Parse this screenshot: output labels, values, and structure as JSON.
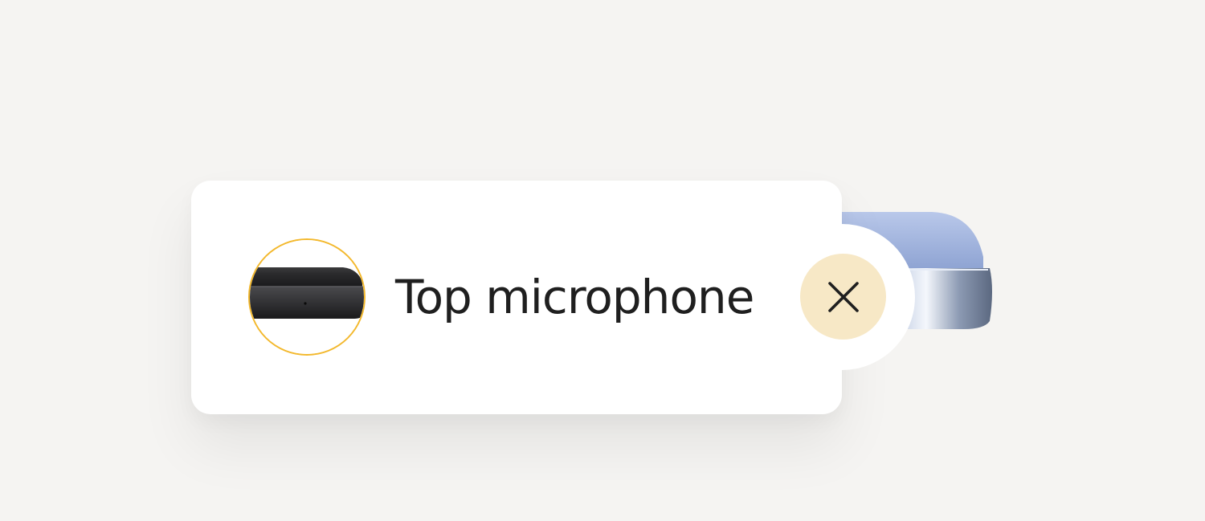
{
  "callout": {
    "label": "Top microphone",
    "thumbnail_icon": "phone-top-edge-microphone",
    "close_icon": "close-icon"
  },
  "colors": {
    "background": "#f5f4f2",
    "card": "#ffffff",
    "thumbnail_ring": "#f3b82c",
    "close_button_fill": "#f7e8c6",
    "close_icon_stroke": "#1f1f1f",
    "text": "#1f1f1f",
    "product_body": "#aebfe3"
  }
}
